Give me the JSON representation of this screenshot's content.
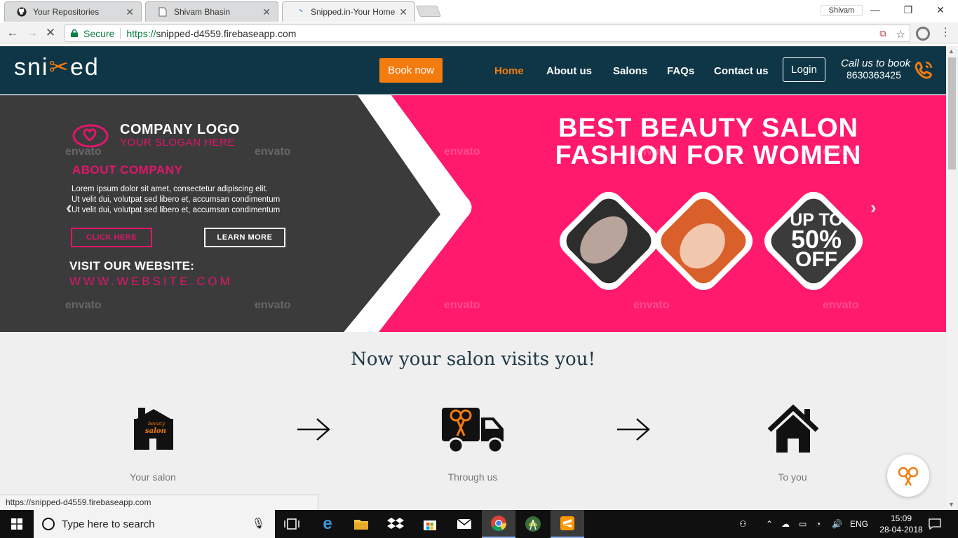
{
  "browser": {
    "tabs": [
      {
        "label": "Your Repositories",
        "icon": "github-icon"
      },
      {
        "label": "Shivam Bhasin",
        "icon": "doc-icon"
      },
      {
        "label": "Snipped.in-Your Home Sa",
        "icon": "loading-icon"
      }
    ],
    "profile_name": "Shivam",
    "secure_label": "Secure",
    "url_scheme": "https://",
    "url_host": "snipped-d4559.firebaseapp.com",
    "status_url": "https://snipped-d4559.firebaseapp.com"
  },
  "site": {
    "logo_pre": "sni",
    "logo_post": "ed",
    "book_now": "Book now",
    "nav": [
      "Home",
      "About us",
      "Salons",
      "FAQs",
      "Contact us"
    ],
    "login": "Login",
    "call_us": "Call us to book",
    "phone": "8630363425",
    "accent": "#f47c0f",
    "header_color": "#0e3646"
  },
  "banner": {
    "company_logo": "COMPANY LOGO",
    "slogan": "YOUR SLOGAN HERE",
    "about": "ABOUT COMPANY",
    "lorem": [
      "Lorem ipsum dolor sit amet, consectetur adipiscing elit.",
      "Ut velit dui, volutpat sed libero et, accumsan condimentum",
      "Ut velit dui, volutpat sed libero et, accumsan condimentum"
    ],
    "click_here": "CLICK HERE",
    "learn_more": "LEARN MORE",
    "visit": "VISIT OUR WEBSITE:",
    "website": "WWW.WEBSITE.COM",
    "headline_1": "BEST BEAUTY SALON",
    "headline_2": "FASHION FOR WOMEN",
    "up_to": "UP TO",
    "percent": "50%",
    "off": "OFF",
    "watermark": "envato",
    "pink": "#ff1a6e"
  },
  "section": {
    "tagline": "Now your salon visits you!",
    "steps": [
      {
        "label": "Your salon",
        "icon": "salon-icon",
        "sign_1": "beauty",
        "sign_2": "salon"
      },
      {
        "label": "Through us",
        "icon": "delivery-truck-icon"
      },
      {
        "label": "To you",
        "icon": "home-icon"
      }
    ]
  },
  "taskbar": {
    "search_placeholder": "Type here to search",
    "language": "ENG",
    "time": "15:09",
    "date": "28-04-2018"
  }
}
